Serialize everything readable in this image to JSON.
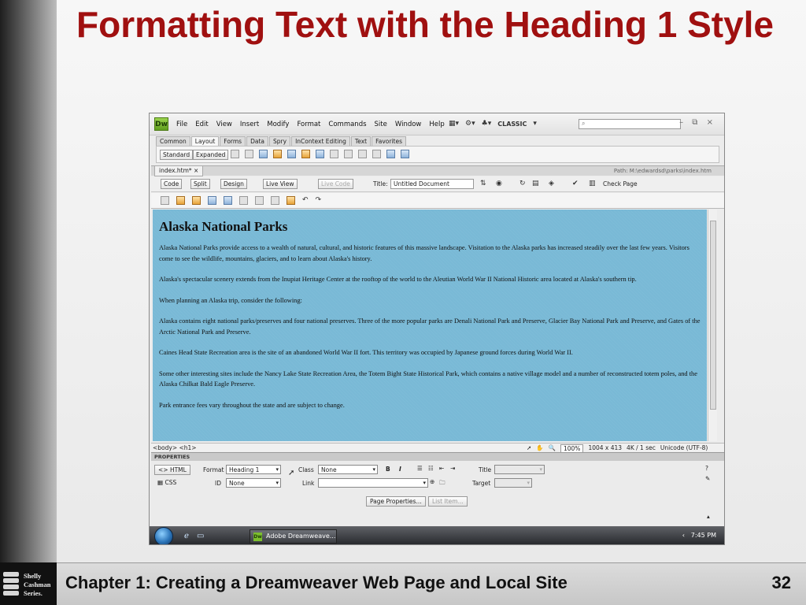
{
  "slide": {
    "title": "Formatting Text with the Heading 1 Style",
    "footer": "Chapter 1: Creating a Dreamweaver Web Page and Local Site",
    "page_number": "32",
    "logo_lines": [
      "Shelly",
      "Cashman",
      "Series."
    ]
  },
  "app": {
    "logo": "Dw",
    "menu": [
      "File",
      "Edit",
      "View",
      "Insert",
      "Modify",
      "Format",
      "Commands",
      "Site",
      "Window",
      "Help"
    ],
    "workspace": "CLASSIC",
    "search_placeholder": "",
    "window_controls": "– ⧉ ×"
  },
  "insert_panel": {
    "tabs": [
      "Common",
      "Layout",
      "Forms",
      "Data",
      "Spry",
      "InContext Editing",
      "Text",
      "Favorites"
    ],
    "active_tab": "Layout",
    "standard_label": "Standard",
    "expanded_label": "Expanded"
  },
  "document": {
    "tab_label": "index.htm*",
    "path": "Path: M:\\edwardsd\\parks\\index.htm",
    "view_buttons": [
      "Code",
      "Split",
      "Design",
      "Live View",
      "Live Code"
    ],
    "title_label": "Title:",
    "title_value": "Untitled Document",
    "check_page": "Check Page"
  },
  "content": {
    "heading": "Alaska National Parks",
    "paragraphs": [
      "Alaska National Parks provide access to a wealth of natural, cultural, and historic features of this massive landscape. Visitation to the Alaska parks has increased steadily over the last few years. Visitors come to see the wildlife, mountains, glaciers, and to learn about Alaska's history.",
      "Alaska's spectacular scenery extends from the Inupiat Heritage Center at the rooftop of the world to the Aleutian World War II National Historic area located at Alaska's southern tip.",
      "When planning an Alaska trip, consider the following:",
      "Alaska contains eight national parks/preserves and four national preserves. Three of the more popular parks are Denali National Park and Preserve, Glacier Bay National Park and Preserve, and Gates of the Arctic National Park and Preserve.",
      "Caines Head State Recreation area is the site of an abandoned World War II fort. This territory was occupied by Japanese ground forces during World War II.",
      "Some other interesting sites include the Nancy Lake State Recreation Area, the Totem Bight State Historical Park, which contains a native village model and a number of reconstructed totem poles, and the Alaska Chilkat Bald Eagle Preserve.",
      "Park entrance fees vary throughout the state and are subject to change."
    ]
  },
  "status": {
    "tag_selector": "<body> <h1>",
    "zoom": "100%",
    "dimensions": "1004 x 413",
    "download": "4K / 1 sec",
    "encoding": "Unicode (UTF-8)"
  },
  "properties": {
    "header": "PROPERTIES",
    "html_btn": "HTML",
    "css_btn": "CSS",
    "format_label": "Format",
    "format_value": "Heading 1",
    "class_label": "Class",
    "class_value": "None",
    "id_label": "ID",
    "id_value": "None",
    "link_label": "Link",
    "link_value": "",
    "bold": "B",
    "italic": "I",
    "title_label": "Title",
    "target_label": "Target",
    "page_properties": "Page Properties...",
    "list_item": "List Item..."
  },
  "taskbar": {
    "task_label": "Adobe Dreamweave...",
    "task_icon": "Dw",
    "clock": "7:45 PM"
  }
}
